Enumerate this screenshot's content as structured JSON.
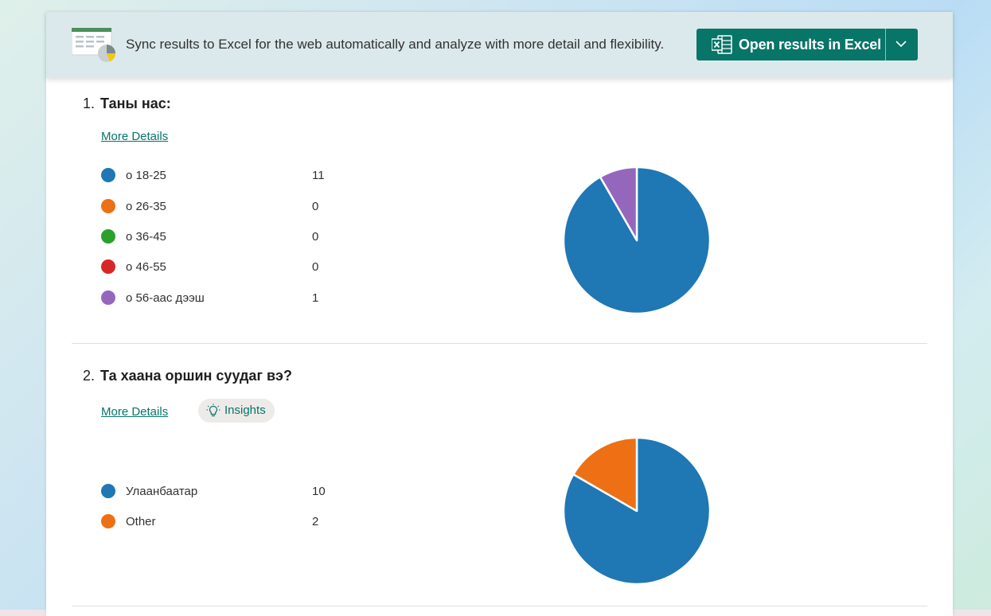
{
  "banner": {
    "message": "Sync results to Excel for the web automatically and analyze with more detail and flexibility.",
    "button_label": "Open results in Excel"
  },
  "questions": [
    {
      "number": "1.",
      "title": "Таны нас:",
      "more_details": "More Details",
      "options": [
        {
          "label": "о 18-25",
          "count": "11",
          "color": "#1f77b4"
        },
        {
          "label": "о 26-35",
          "count": "0",
          "color": "#ed7014"
        },
        {
          "label": "о 36-45",
          "count": "0",
          "color": "#2ca02c"
        },
        {
          "label": "о 46-55",
          "count": "0",
          "color": "#d62728"
        },
        {
          "label": "о 56-аас дээш",
          "count": "1",
          "color": "#9467bd"
        }
      ]
    },
    {
      "number": "2.",
      "title": "Та хаана оршин суудаг вэ?",
      "more_details": "More Details",
      "insights": "Insights",
      "options": [
        {
          "label": "Улаанбаатар",
          "count": "10",
          "color": "#1f77b4"
        },
        {
          "label": "Other",
          "count": "2",
          "color": "#ed7014"
        }
      ]
    }
  ],
  "chart_data": [
    {
      "type": "pie",
      "categories": [
        "о 18-25",
        "о 26-35",
        "о 36-45",
        "о 46-55",
        "о 56-аас дээш"
      ],
      "values": [
        11,
        0,
        0,
        0,
        1
      ],
      "colors": [
        "#1f77b4",
        "#ed7014",
        "#2ca02c",
        "#d62728",
        "#9467bd"
      ]
    },
    {
      "type": "pie",
      "categories": [
        "Улаанбаатар",
        "Other"
      ],
      "values": [
        10,
        2
      ],
      "colors": [
        "#1f77b4",
        "#ed7014"
      ]
    }
  ]
}
